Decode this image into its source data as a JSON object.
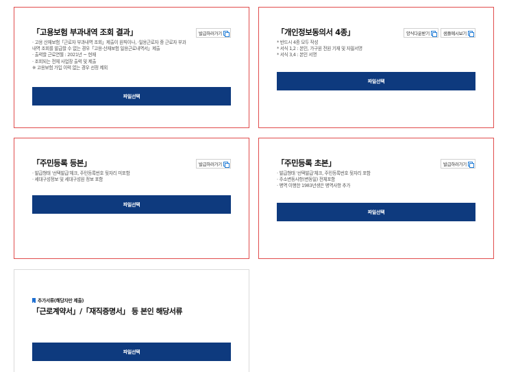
{
  "cards": [
    {
      "title": "「고용보험 부과내역 조회 결과」",
      "buttons": [
        {
          "label": "발급하러가기",
          "icon": "copy-icon"
        }
      ],
      "desc": [
        "· 고용 산재보험「근로자 부과내역 조회」제출이 원칙이나, ·일용근로자 중 근로자 부과",
        "내역 조회를 발급할 수 없는 경우「고용·산재보험 일용근로내역서」제출",
        "· 출력할 근로연월 : 2021년 ~ 현재",
        "· 조회되는 전체 사업장 출력 및 제출",
        "※ 고용보험 가입 이력 없는 경우 선정 제외"
      ],
      "file_button": "파일선택"
    },
    {
      "title": "「개인정보동의서 4종」",
      "buttons": [
        {
          "label": "양식다운받기",
          "icon": "copy-icon"
        },
        {
          "label": "샘플예시보기",
          "icon": "copy-icon"
        }
      ],
      "desc": [
        "* 반드시 4종 모두 작성",
        "* 서식 1,2 : 본인, 가구원 전원 기재 및 자필서명",
        "* 서식 3,4 : 본인 서명"
      ],
      "file_button": "파일선택"
    },
    {
      "title": "「주민등록 등본」",
      "buttons": [
        {
          "label": "발급하러가기",
          "icon": "copy-icon"
        }
      ],
      "desc": [
        "· 발급형태 '선택발급'체크, 주민등록번호 뒷자리 미포함",
        "· 세대구성정보 및 세대구성원 정보 포함"
      ],
      "file_button": "파일선택"
    },
    {
      "title": "「주민등록 초본」",
      "buttons": [
        {
          "label": "발급하러가기",
          "icon": "copy-icon"
        }
      ],
      "desc": [
        "· 발급형태 '선택발급'체크, 주민등록번호 뒷자리 포함",
        "· 주소변동사항(변동일) 전체포함",
        "· 병역 이행한 1983년생은 병역사항 추가"
      ],
      "file_button": "파일선택"
    },
    {
      "tag": "추가서류(해당자만 제출)",
      "title": "「근로계약서」/「재직증명서」 등 본인 해당서류",
      "file_button": "파일선택"
    }
  ],
  "colors": {
    "primary_button": "#0e3a7e",
    "card_border_highlight": "#e04a4a",
    "card_border_neutral": "#d9d9d9",
    "icon_accent": "#1e7bd6"
  }
}
